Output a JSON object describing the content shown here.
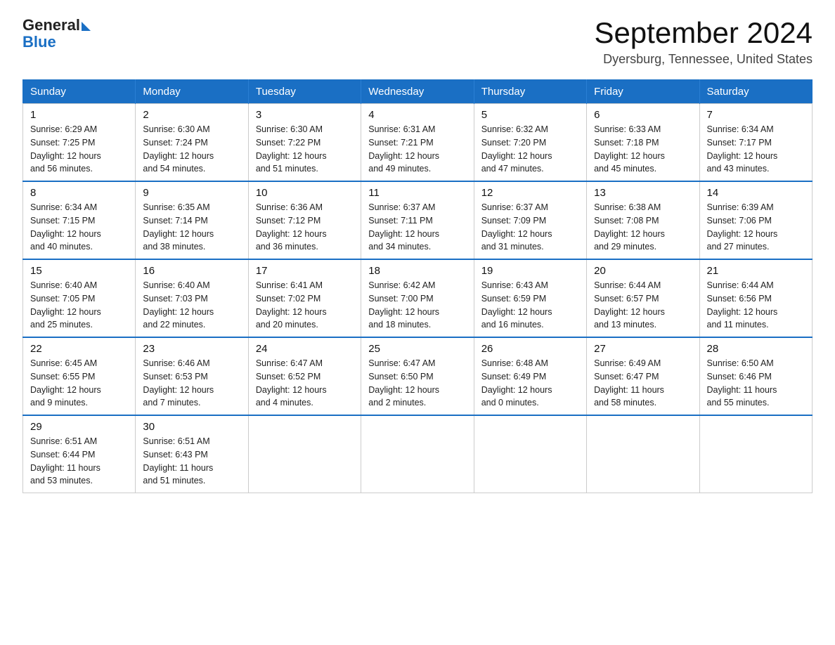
{
  "logo": {
    "general": "General",
    "blue": "Blue"
  },
  "header": {
    "title": "September 2024",
    "subtitle": "Dyersburg, Tennessee, United States"
  },
  "weekdays": [
    "Sunday",
    "Monday",
    "Tuesday",
    "Wednesday",
    "Thursday",
    "Friday",
    "Saturday"
  ],
  "weeks": [
    [
      {
        "day": "1",
        "sunrise": "6:29 AM",
        "sunset": "7:25 PM",
        "daylight": "12 hours and 56 minutes."
      },
      {
        "day": "2",
        "sunrise": "6:30 AM",
        "sunset": "7:24 PM",
        "daylight": "12 hours and 54 minutes."
      },
      {
        "day": "3",
        "sunrise": "6:30 AM",
        "sunset": "7:22 PM",
        "daylight": "12 hours and 51 minutes."
      },
      {
        "day": "4",
        "sunrise": "6:31 AM",
        "sunset": "7:21 PM",
        "daylight": "12 hours and 49 minutes."
      },
      {
        "day": "5",
        "sunrise": "6:32 AM",
        "sunset": "7:20 PM",
        "daylight": "12 hours and 47 minutes."
      },
      {
        "day": "6",
        "sunrise": "6:33 AM",
        "sunset": "7:18 PM",
        "daylight": "12 hours and 45 minutes."
      },
      {
        "day": "7",
        "sunrise": "6:34 AM",
        "sunset": "7:17 PM",
        "daylight": "12 hours and 43 minutes."
      }
    ],
    [
      {
        "day": "8",
        "sunrise": "6:34 AM",
        "sunset": "7:15 PM",
        "daylight": "12 hours and 40 minutes."
      },
      {
        "day": "9",
        "sunrise": "6:35 AM",
        "sunset": "7:14 PM",
        "daylight": "12 hours and 38 minutes."
      },
      {
        "day": "10",
        "sunrise": "6:36 AM",
        "sunset": "7:12 PM",
        "daylight": "12 hours and 36 minutes."
      },
      {
        "day": "11",
        "sunrise": "6:37 AM",
        "sunset": "7:11 PM",
        "daylight": "12 hours and 34 minutes."
      },
      {
        "day": "12",
        "sunrise": "6:37 AM",
        "sunset": "7:09 PM",
        "daylight": "12 hours and 31 minutes."
      },
      {
        "day": "13",
        "sunrise": "6:38 AM",
        "sunset": "7:08 PM",
        "daylight": "12 hours and 29 minutes."
      },
      {
        "day": "14",
        "sunrise": "6:39 AM",
        "sunset": "7:06 PM",
        "daylight": "12 hours and 27 minutes."
      }
    ],
    [
      {
        "day": "15",
        "sunrise": "6:40 AM",
        "sunset": "7:05 PM",
        "daylight": "12 hours and 25 minutes."
      },
      {
        "day": "16",
        "sunrise": "6:40 AM",
        "sunset": "7:03 PM",
        "daylight": "12 hours and 22 minutes."
      },
      {
        "day": "17",
        "sunrise": "6:41 AM",
        "sunset": "7:02 PM",
        "daylight": "12 hours and 20 minutes."
      },
      {
        "day": "18",
        "sunrise": "6:42 AM",
        "sunset": "7:00 PM",
        "daylight": "12 hours and 18 minutes."
      },
      {
        "day": "19",
        "sunrise": "6:43 AM",
        "sunset": "6:59 PM",
        "daylight": "12 hours and 16 minutes."
      },
      {
        "day": "20",
        "sunrise": "6:44 AM",
        "sunset": "6:57 PM",
        "daylight": "12 hours and 13 minutes."
      },
      {
        "day": "21",
        "sunrise": "6:44 AM",
        "sunset": "6:56 PM",
        "daylight": "12 hours and 11 minutes."
      }
    ],
    [
      {
        "day": "22",
        "sunrise": "6:45 AM",
        "sunset": "6:55 PM",
        "daylight": "12 hours and 9 minutes."
      },
      {
        "day": "23",
        "sunrise": "6:46 AM",
        "sunset": "6:53 PM",
        "daylight": "12 hours and 7 minutes."
      },
      {
        "day": "24",
        "sunrise": "6:47 AM",
        "sunset": "6:52 PM",
        "daylight": "12 hours and 4 minutes."
      },
      {
        "day": "25",
        "sunrise": "6:47 AM",
        "sunset": "6:50 PM",
        "daylight": "12 hours and 2 minutes."
      },
      {
        "day": "26",
        "sunrise": "6:48 AM",
        "sunset": "6:49 PM",
        "daylight": "12 hours and 0 minutes."
      },
      {
        "day": "27",
        "sunrise": "6:49 AM",
        "sunset": "6:47 PM",
        "daylight": "11 hours and 58 minutes."
      },
      {
        "day": "28",
        "sunrise": "6:50 AM",
        "sunset": "6:46 PM",
        "daylight": "11 hours and 55 minutes."
      }
    ],
    [
      {
        "day": "29",
        "sunrise": "6:51 AM",
        "sunset": "6:44 PM",
        "daylight": "11 hours and 53 minutes."
      },
      {
        "day": "30",
        "sunrise": "6:51 AM",
        "sunset": "6:43 PM",
        "daylight": "11 hours and 51 minutes."
      },
      null,
      null,
      null,
      null,
      null
    ]
  ],
  "labels": {
    "sunrise": "Sunrise:",
    "sunset": "Sunset:",
    "daylight": "Daylight:"
  }
}
